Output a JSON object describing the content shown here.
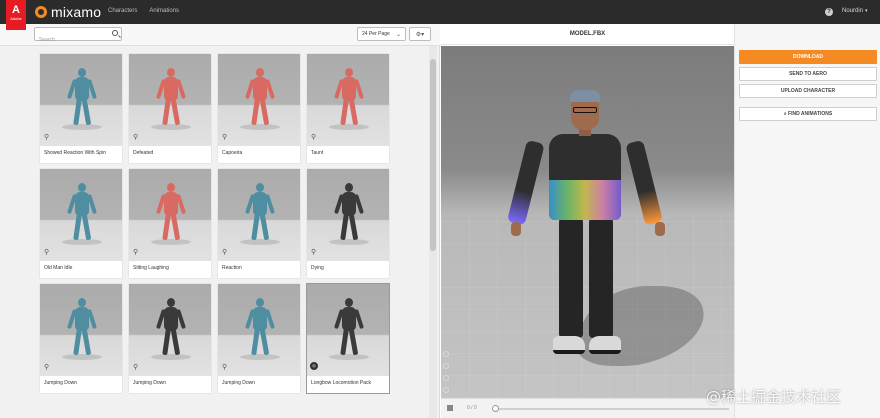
{
  "header": {
    "adobe_letter": "A",
    "adobe_text": "Adobe",
    "brand": "mixamo",
    "nav": [
      "Characters",
      "Animations"
    ],
    "help_icon": "?",
    "user": "Nourdin"
  },
  "toolbar": {
    "search_placeholder": "Search",
    "per_page": "24 Per Page",
    "settings_icon": "gear-icon"
  },
  "animations": [
    {
      "label": "Showed Reaction With Spin",
      "color": "#4f8da0"
    },
    {
      "label": "Defeated",
      "color": "#d86a62"
    },
    {
      "label": "Capoeira",
      "color": "#d86a62"
    },
    {
      "label": "Taunt",
      "color": "#d86a62"
    },
    {
      "label": "Old Man Idle",
      "color": "#4f8da0"
    },
    {
      "label": "Sitting Laughing",
      "color": "#d86a62"
    },
    {
      "label": "Reaction",
      "color": "#4f8da0"
    },
    {
      "label": "Dying",
      "color": "#3a3a3a"
    },
    {
      "label": "Jumping Down",
      "color": "#4f8da0"
    },
    {
      "label": "Jumping Down",
      "color": "#3a3a3a"
    },
    {
      "label": "Jumping Down",
      "color": "#4f8da0"
    },
    {
      "label": "Longbow Locomotion Pack",
      "color": "#3a3a3a"
    }
  ],
  "viewer": {
    "title": "MODEL.FBX",
    "frame": "0 / 0"
  },
  "actions": {
    "download": "DOWNLOAD",
    "send_to_aero": "SEND TO AERO",
    "upload_character": "UPLOAD CHARACTER",
    "find_animations": "FIND ANIMATIONS"
  },
  "watermark": "@稀土掘金技术社区",
  "colors": {
    "accent": "#f48a21",
    "topbar": "#2b2b2b",
    "adobe_red": "#e61b23"
  }
}
